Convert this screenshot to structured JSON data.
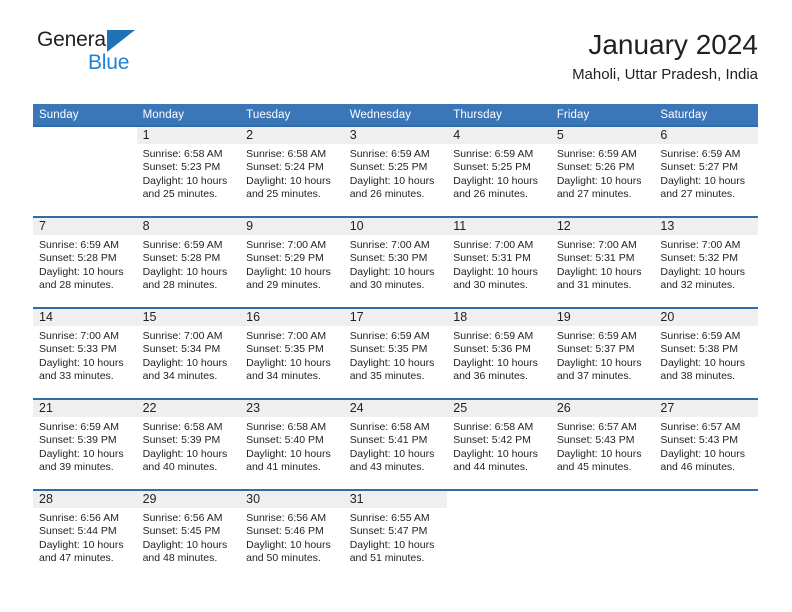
{
  "brand": {
    "name_part1": "General",
    "name_part2": "Blue",
    "triangle_icon": "triangle-icon",
    "color_dark": "#231f20",
    "color_blue": "#1f83d6"
  },
  "header": {
    "title": "January 2024",
    "subtitle": "Maholi, Uttar Pradesh, India"
  },
  "theme": {
    "header_bg": "#3a76b8",
    "row_border": "#2e6da8",
    "daynum_bg": "#efeff0",
    "text": "#231f20"
  },
  "calendar": {
    "weekday_headers": [
      "Sunday",
      "Monday",
      "Tuesday",
      "Wednesday",
      "Thursday",
      "Friday",
      "Saturday"
    ],
    "weeks": [
      [
        {
          "day": "",
          "lines": []
        },
        {
          "day": "1",
          "lines": [
            "Sunrise: 6:58 AM",
            "Sunset: 5:23 PM",
            "Daylight: 10 hours",
            "and 25 minutes."
          ]
        },
        {
          "day": "2",
          "lines": [
            "Sunrise: 6:58 AM",
            "Sunset: 5:24 PM",
            "Daylight: 10 hours",
            "and 25 minutes."
          ]
        },
        {
          "day": "3",
          "lines": [
            "Sunrise: 6:59 AM",
            "Sunset: 5:25 PM",
            "Daylight: 10 hours",
            "and 26 minutes."
          ]
        },
        {
          "day": "4",
          "lines": [
            "Sunrise: 6:59 AM",
            "Sunset: 5:25 PM",
            "Daylight: 10 hours",
            "and 26 minutes."
          ]
        },
        {
          "day": "5",
          "lines": [
            "Sunrise: 6:59 AM",
            "Sunset: 5:26 PM",
            "Daylight: 10 hours",
            "and 27 minutes."
          ]
        },
        {
          "day": "6",
          "lines": [
            "Sunrise: 6:59 AM",
            "Sunset: 5:27 PM",
            "Daylight: 10 hours",
            "and 27 minutes."
          ]
        }
      ],
      [
        {
          "day": "7",
          "lines": [
            "Sunrise: 6:59 AM",
            "Sunset: 5:28 PM",
            "Daylight: 10 hours",
            "and 28 minutes."
          ]
        },
        {
          "day": "8",
          "lines": [
            "Sunrise: 6:59 AM",
            "Sunset: 5:28 PM",
            "Daylight: 10 hours",
            "and 28 minutes."
          ]
        },
        {
          "day": "9",
          "lines": [
            "Sunrise: 7:00 AM",
            "Sunset: 5:29 PM",
            "Daylight: 10 hours",
            "and 29 minutes."
          ]
        },
        {
          "day": "10",
          "lines": [
            "Sunrise: 7:00 AM",
            "Sunset: 5:30 PM",
            "Daylight: 10 hours",
            "and 30 minutes."
          ]
        },
        {
          "day": "11",
          "lines": [
            "Sunrise: 7:00 AM",
            "Sunset: 5:31 PM",
            "Daylight: 10 hours",
            "and 30 minutes."
          ]
        },
        {
          "day": "12",
          "lines": [
            "Sunrise: 7:00 AM",
            "Sunset: 5:31 PM",
            "Daylight: 10 hours",
            "and 31 minutes."
          ]
        },
        {
          "day": "13",
          "lines": [
            "Sunrise: 7:00 AM",
            "Sunset: 5:32 PM",
            "Daylight: 10 hours",
            "and 32 minutes."
          ]
        }
      ],
      [
        {
          "day": "14",
          "lines": [
            "Sunrise: 7:00 AM",
            "Sunset: 5:33 PM",
            "Daylight: 10 hours",
            "and 33 minutes."
          ]
        },
        {
          "day": "15",
          "lines": [
            "Sunrise: 7:00 AM",
            "Sunset: 5:34 PM",
            "Daylight: 10 hours",
            "and 34 minutes."
          ]
        },
        {
          "day": "16",
          "lines": [
            "Sunrise: 7:00 AM",
            "Sunset: 5:35 PM",
            "Daylight: 10 hours",
            "and 34 minutes."
          ]
        },
        {
          "day": "17",
          "lines": [
            "Sunrise: 6:59 AM",
            "Sunset: 5:35 PM",
            "Daylight: 10 hours",
            "and 35 minutes."
          ]
        },
        {
          "day": "18",
          "lines": [
            "Sunrise: 6:59 AM",
            "Sunset: 5:36 PM",
            "Daylight: 10 hours",
            "and 36 minutes."
          ]
        },
        {
          "day": "19",
          "lines": [
            "Sunrise: 6:59 AM",
            "Sunset: 5:37 PM",
            "Daylight: 10 hours",
            "and 37 minutes."
          ]
        },
        {
          "day": "20",
          "lines": [
            "Sunrise: 6:59 AM",
            "Sunset: 5:38 PM",
            "Daylight: 10 hours",
            "and 38 minutes."
          ]
        }
      ],
      [
        {
          "day": "21",
          "lines": [
            "Sunrise: 6:59 AM",
            "Sunset: 5:39 PM",
            "Daylight: 10 hours",
            "and 39 minutes."
          ]
        },
        {
          "day": "22",
          "lines": [
            "Sunrise: 6:58 AM",
            "Sunset: 5:39 PM",
            "Daylight: 10 hours",
            "and 40 minutes."
          ]
        },
        {
          "day": "23",
          "lines": [
            "Sunrise: 6:58 AM",
            "Sunset: 5:40 PM",
            "Daylight: 10 hours",
            "and 41 minutes."
          ]
        },
        {
          "day": "24",
          "lines": [
            "Sunrise: 6:58 AM",
            "Sunset: 5:41 PM",
            "Daylight: 10 hours",
            "and 43 minutes."
          ]
        },
        {
          "day": "25",
          "lines": [
            "Sunrise: 6:58 AM",
            "Sunset: 5:42 PM",
            "Daylight: 10 hours",
            "and 44 minutes."
          ]
        },
        {
          "day": "26",
          "lines": [
            "Sunrise: 6:57 AM",
            "Sunset: 5:43 PM",
            "Daylight: 10 hours",
            "and 45 minutes."
          ]
        },
        {
          "day": "27",
          "lines": [
            "Sunrise: 6:57 AM",
            "Sunset: 5:43 PM",
            "Daylight: 10 hours",
            "and 46 minutes."
          ]
        }
      ],
      [
        {
          "day": "28",
          "lines": [
            "Sunrise: 6:56 AM",
            "Sunset: 5:44 PM",
            "Daylight: 10 hours",
            "and 47 minutes."
          ]
        },
        {
          "day": "29",
          "lines": [
            "Sunrise: 6:56 AM",
            "Sunset: 5:45 PM",
            "Daylight: 10 hours",
            "and 48 minutes."
          ]
        },
        {
          "day": "30",
          "lines": [
            "Sunrise: 6:56 AM",
            "Sunset: 5:46 PM",
            "Daylight: 10 hours",
            "and 50 minutes."
          ]
        },
        {
          "day": "31",
          "lines": [
            "Sunrise: 6:55 AM",
            "Sunset: 5:47 PM",
            "Daylight: 10 hours",
            "and 51 minutes."
          ]
        },
        {
          "day": "",
          "lines": []
        },
        {
          "day": "",
          "lines": []
        },
        {
          "day": "",
          "lines": []
        }
      ]
    ]
  }
}
